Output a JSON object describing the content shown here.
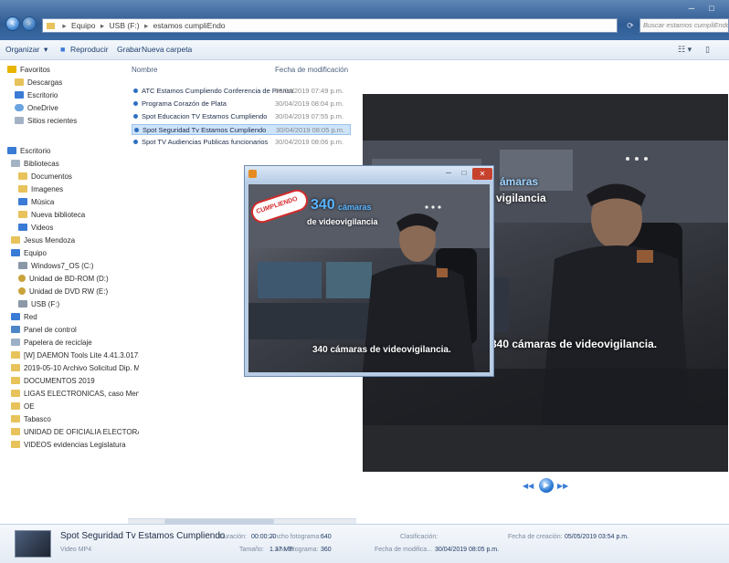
{
  "address": {
    "crumbs": [
      "Equipo",
      "USB (F:)",
      "estamos cumpliEndo"
    ],
    "search_placeholder": "Buscar estamos cumpliEndo"
  },
  "toolbar": {
    "organize": "Organizar",
    "play": "Reproducir",
    "burn": "Grabar",
    "new_folder": "Nueva carpeta"
  },
  "sidebar": {
    "items": [
      {
        "label": "Favoritos",
        "icon": "star-icon"
      },
      {
        "label": "Descargas",
        "icon": "folder-icon"
      },
      {
        "label": "Escritorio",
        "icon": "desktop-icon"
      },
      {
        "label": "OneDrive",
        "icon": "cloud-icon"
      },
      {
        "label": "Sitios recientes",
        "icon": "recent-icon"
      },
      {
        "label": "Escritorio",
        "icon": "desktop-icon"
      },
      {
        "label": "Bibliotecas",
        "icon": "library-icon"
      },
      {
        "label": "Documentos",
        "icon": "folder-icon"
      },
      {
        "label": "Imagenes",
        "icon": "folder-icon"
      },
      {
        "label": "Música",
        "icon": "music-icon"
      },
      {
        "label": "Nueva biblioteca",
        "icon": "folder-icon"
      },
      {
        "label": "Videos",
        "icon": "video-icon"
      },
      {
        "label": "Jesus Mendoza",
        "icon": "user-icon"
      },
      {
        "label": "Equipo",
        "icon": "computer-icon"
      },
      {
        "label": "Windows7_OS (C:)",
        "icon": "drive-icon"
      },
      {
        "label": "Unidad de BD-ROM (D:)",
        "icon": "disc-icon"
      },
      {
        "label": "Unidad de DVD RW (E:)",
        "icon": "disc-icon"
      },
      {
        "label": "USB (F:)",
        "icon": "usb-icon"
      },
      {
        "label": "Red",
        "icon": "network-icon"
      },
      {
        "label": "Panel de control",
        "icon": "control-panel-icon"
      },
      {
        "label": "Papelera de reciclaje",
        "icon": "trash-icon"
      },
      {
        "label": "[W] DAEMON Tools Lite 4.41.3.0173",
        "icon": "folder-icon"
      },
      {
        "label": "2019-05-10 Archivo Solicitud Dip. Mi",
        "icon": "folder-icon"
      },
      {
        "label": "DOCUMENTOS 2019",
        "icon": "folder-icon"
      },
      {
        "label": "LIGAS ELECTRONICAS, caso Menchac",
        "icon": "folder-icon"
      },
      {
        "label": "OE",
        "icon": "folder-icon"
      },
      {
        "label": "Tabasco",
        "icon": "folder-icon"
      },
      {
        "label": "UNIDAD DE OFICIALIA ELECTORAL (",
        "icon": "folder-icon"
      },
      {
        "label": "VIDEOS evidencias Legislatura",
        "icon": "folder-icon"
      }
    ]
  },
  "filelist": {
    "col_name": "Nombre",
    "col_date": "Fecha de modificación",
    "rows": [
      {
        "name": "ATC Estamos Cumpliendo Conferencia de Prensa",
        "date": "30/04/2019 07:49 p.m."
      },
      {
        "name": "Programa Corazón de Plata",
        "date": "30/04/2019 08:04 p.m."
      },
      {
        "name": "Spot Educacion TV Estamos Cumpliendo",
        "date": "30/04/2019 07:55 p.m."
      },
      {
        "name": "Spot Seguridad Tv Estamos Cumpliendo",
        "date": "30/04/2019 08:05 p.m."
      },
      {
        "name": "Spot TV Audiencias Publicas funcionarios",
        "date": "30/04/2019 08:06 p.m."
      }
    ]
  },
  "video": {
    "caption": "340 cámaras de videovigilancia.",
    "overlay_number": "340",
    "overlay_word1": "cámaras",
    "overlay_word2": "de videovigilancia",
    "badge": "CUMPLIENDO",
    "partial_overlay_1": "ámaras",
    "partial_overlay_2": "vigilancia"
  },
  "details": {
    "title": "Spot Seguridad Tv Estamos Cumpliendo",
    "type": "Video MP4",
    "duration_label": "Duración:",
    "duration": "00:00:20",
    "size_label": "Tamaño:",
    "size": "1.37 MB",
    "width_label": "Ancho fotograma:",
    "width": "640",
    "height_label": "Alto fotograma:",
    "height": "360",
    "rating_label": "Clasificación:",
    "modified_label": "Fecha de modifica...",
    "modified": "30/04/2019 08:05 p.m.",
    "created_label": "Fecha de creación:",
    "created": "05/05/2019 03:54 p.m."
  },
  "colors": {
    "title_bar": "#2f5c93",
    "selection": "#cde3f8",
    "accent": "#3a7bd5"
  }
}
